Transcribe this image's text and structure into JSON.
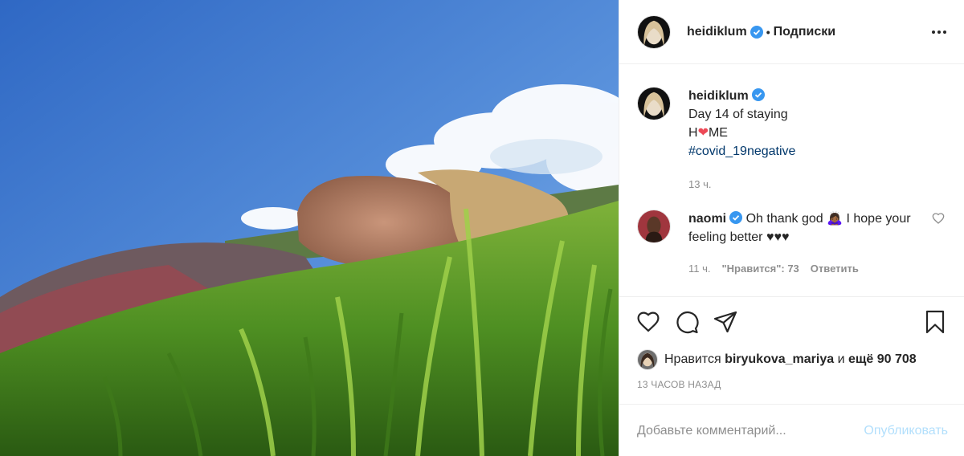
{
  "header": {
    "username": "heidiklum",
    "separator": "•",
    "follow_label": "Подписки"
  },
  "caption": {
    "username": "heidiklum",
    "line1": "Day 14 of staying",
    "line2_prefix": "H",
    "line2_heart": "❤",
    "line2_suffix": "ME",
    "hashtag": "#covid_19negative",
    "time": "13 ч."
  },
  "comment": {
    "username": "naomi",
    "text_part1": "Oh thank god",
    "emoji": "🙇🏾‍♀️",
    "text_part2": "I hope your feeling better ♥♥♥",
    "time": "11 ч.",
    "likes_label": "\"Нравится\": 73",
    "reply_label": "Ответить"
  },
  "likes": {
    "prefix": "Нравится",
    "user": "biryukova_mariya",
    "and": "и",
    "count_text": "ещё 90 708"
  },
  "timestamp": "13 ЧАСОВ НАЗАД",
  "add_comment": {
    "placeholder": "Добавьте комментарий...",
    "publish_label": "Опубликовать"
  },
  "colors": {
    "verified_blue": "#3897f0",
    "hashtag_blue": "#00376b",
    "publish_disabled": "#b2dffc",
    "heart_red": "#ed4956"
  }
}
